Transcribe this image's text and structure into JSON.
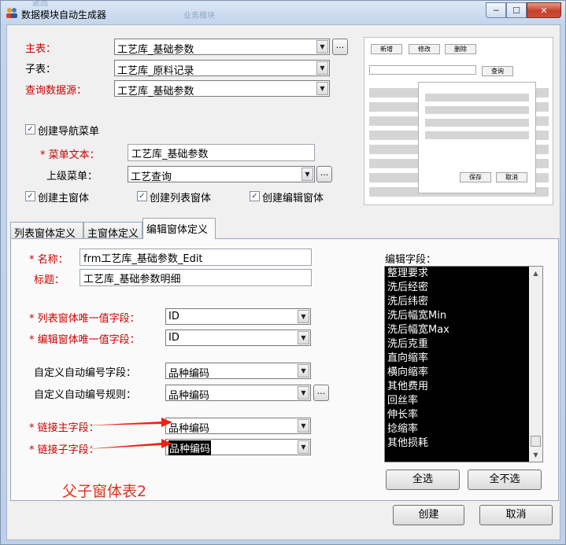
{
  "window": {
    "title": "数据模块自动生成器",
    "ghost_bg_text": "业务模块",
    "ghost_bg_text2": "返回",
    "close_glyph": "✕",
    "minimize_glyph": "─",
    "maximize_glyph": "☐"
  },
  "top": {
    "master_label": "主表：",
    "master_value": "工艺库_基础参数",
    "child_label": "子表：",
    "child_value": "工艺库_原料记录",
    "query_label": "查询数据源：",
    "query_value": "工艺库_基础参数",
    "ellipsis": "..."
  },
  "nav": {
    "create_nav_label": "创建导航菜单",
    "menu_text_label": "* 菜单文本：",
    "menu_text_value": "工艺库_基础参数",
    "parent_menu_label": "上级菜单：",
    "parent_menu_value": "工艺查询",
    "create_main_label": "创建主窗体",
    "create_list_label": "创建列表窗体",
    "create_edit_label": "创建编辑窗体",
    "check_glyph": "✓"
  },
  "preview": {
    "add": "新增",
    "edit": "修改",
    "delete": "删除",
    "query": "查询",
    "save": "保存",
    "cancel": "取消"
  },
  "tabs": [
    {
      "label": "列表窗体定义"
    },
    {
      "label": "主窗体定义"
    },
    {
      "label": "编辑窗体定义"
    }
  ],
  "form": {
    "name_label": "* 名称：",
    "name_value": "frm工艺库_基础参数_Edit",
    "title_label": "标题：",
    "title_value": "工艺库_基础参数明细",
    "list_unique_label": "* 列表窗体唯一值字段：",
    "list_unique_value": "ID",
    "edit_unique_label": "* 编辑窗体唯一值字段：",
    "edit_unique_value": "ID",
    "auto_code_field_label": "自定义自动编号字段：",
    "auto_code_field_value": "品种编码",
    "auto_code_rule_label": "自定义自动编号规则：",
    "auto_code_rule_value": "品种编码",
    "link_master_label": "* 链接主字段：",
    "link_master_value": "品种编码",
    "link_child_label": "* 链接子字段：",
    "link_child_value": "品种编码"
  },
  "fields": {
    "label": "编辑字段：",
    "items": [
      "整理要求",
      "洗后经密",
      "洗后纬密",
      "洗后幅宽Min",
      "洗后幅宽Max",
      "洗后克重",
      "直向缩率",
      "横向缩率",
      "其他费用",
      "回丝率",
      "伸长率",
      "捻缩率",
      "其他损耗"
    ],
    "select_all": "全选",
    "select_none": "全不选"
  },
  "annotation": "父子窗体表2",
  "footer": {
    "create": "创建",
    "cancel": "取消"
  },
  "colors": {
    "required_label": "#cc0000",
    "annotation": "#dd3322"
  }
}
